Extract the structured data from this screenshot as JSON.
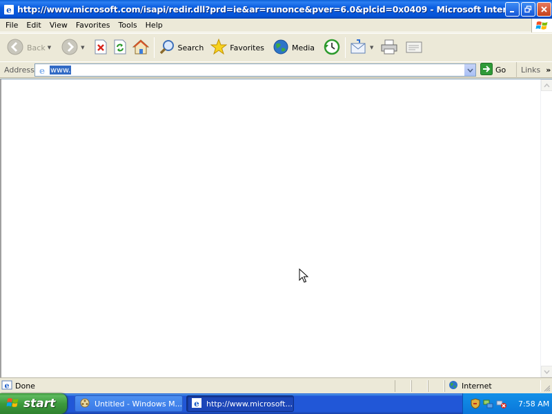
{
  "window": {
    "title": "http://www.microsoft.com/isapi/redir.dll?prd=ie&ar=runonce&pver=6.0&plcid=0x0409 - Microsoft Internet Ex..."
  },
  "menu": {
    "items": [
      "File",
      "Edit",
      "View",
      "Favorites",
      "Tools",
      "Help"
    ]
  },
  "toolbar": {
    "back_label": "Back",
    "search_label": "Search",
    "favorites_label": "Favorites",
    "media_label": "Media"
  },
  "address": {
    "label": "Address",
    "value": "www.",
    "go_label": "Go",
    "links_label": "Links"
  },
  "status": {
    "text": "Done",
    "zone": "Internet"
  },
  "taskbar": {
    "start_label": "start",
    "tasks": [
      {
        "label": "Untitled - Windows M..."
      },
      {
        "label": "http://www.microsoft..."
      }
    ],
    "clock": "7:58 AM"
  },
  "colors": {
    "titlebar": "#0653d6",
    "taskbar": "#2157d7",
    "start": "#3c9a3c",
    "selection": "#316ac5"
  }
}
